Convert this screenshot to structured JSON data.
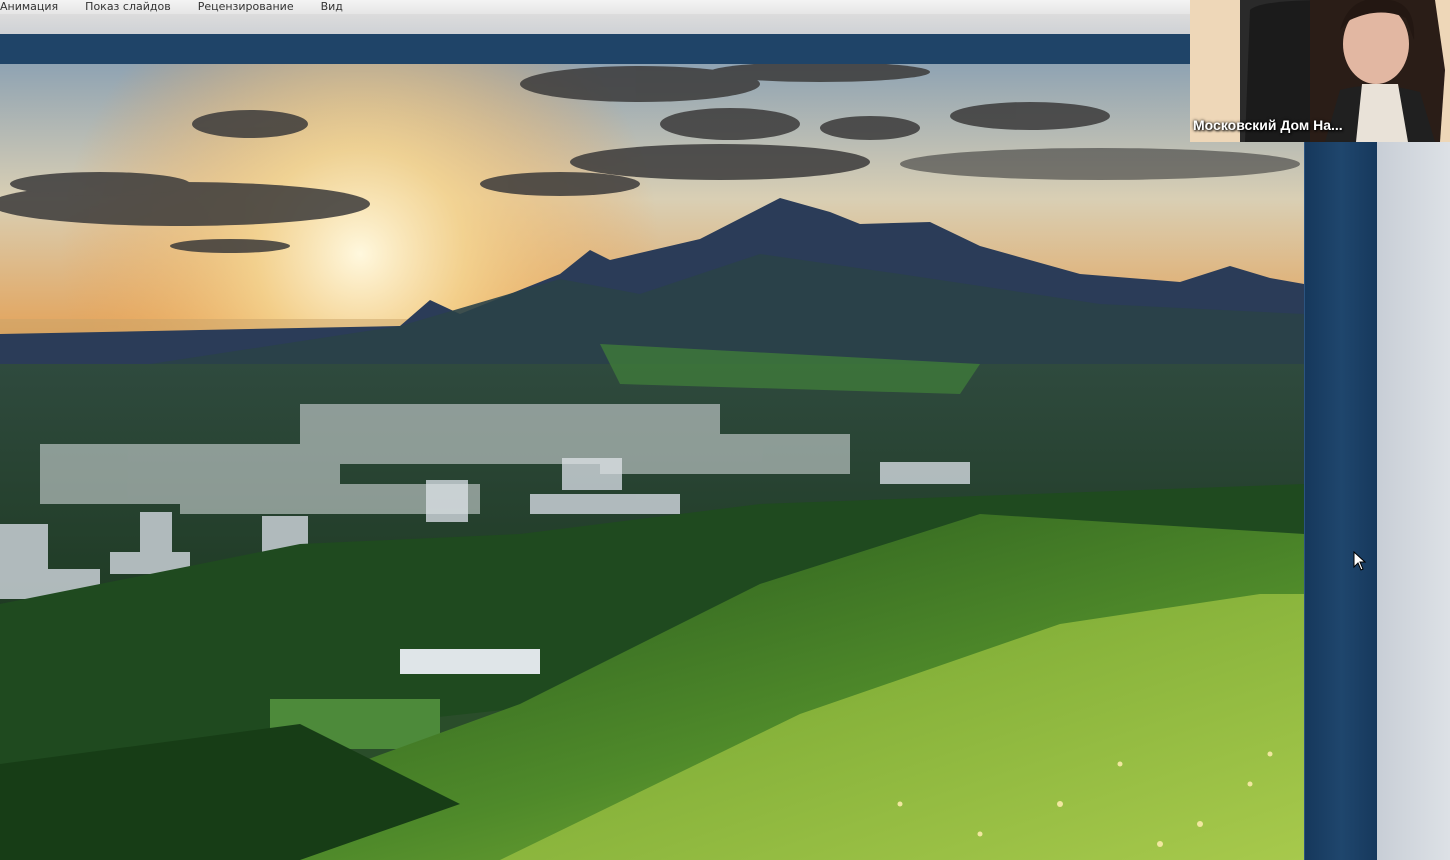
{
  "menu": {
    "tabs": [
      "Анимация",
      "Показ слайдов",
      "Рецензирование",
      "Вид"
    ]
  },
  "webcam": {
    "participant_name": "Московский Дом На..."
  },
  "icons": {
    "cursor": "mouse-pointer-icon"
  },
  "colors": {
    "band": "#1f4468",
    "side_panel": "#1a3d63"
  }
}
